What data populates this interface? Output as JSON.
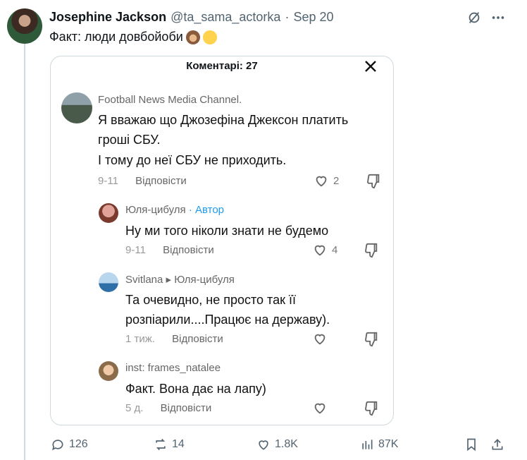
{
  "post": {
    "author_name": "Josephine Jackson",
    "handle": "@ta_sama_actorka",
    "separator": "·",
    "date": "Sep 20",
    "text": "Факт: люди довбойоби",
    "emojis": [
      "see-no-evil-monkey",
      "laughing-face"
    ]
  },
  "card": {
    "title": "Коментарі: 27",
    "comments": [
      {
        "author": "Football News Media Channel.",
        "text_lines": [
          "Я вважаю що Джозефіна Джексон платить",
          "гроші СБУ.",
          "І тому до неї СБУ не приходить."
        ],
        "date": "9-11",
        "reply_label": "Відповісти",
        "likes": "2"
      },
      {
        "author": "Юля-цибуля",
        "author_badge": "· Автор",
        "text_lines": [
          "Ну ми того ніколи знати не будемо"
        ],
        "date": "9-11",
        "reply_label": "Відповісти",
        "likes": "4"
      },
      {
        "author": "Svitlana",
        "reply_to": "Юля-цибуля",
        "text_lines": [
          "Та очевидно, не просто так її",
          "розпіарили....Працює на державу)."
        ],
        "date": "1 тиж.",
        "reply_label": "Відповісти",
        "likes": ""
      },
      {
        "author": "inst: frames_natalee",
        "text_lines": [
          "Факт. Вона дає на лапу)"
        ],
        "date": "5 д.",
        "reply_label": "Відповісти",
        "likes": ""
      }
    ]
  },
  "actions": {
    "replies": "126",
    "reposts": "14",
    "likes": "1.8K",
    "views": "87K"
  },
  "colors": {
    "accent_blue": "#1d9bf0",
    "muted": "#536471",
    "border": "#cfd9de"
  }
}
